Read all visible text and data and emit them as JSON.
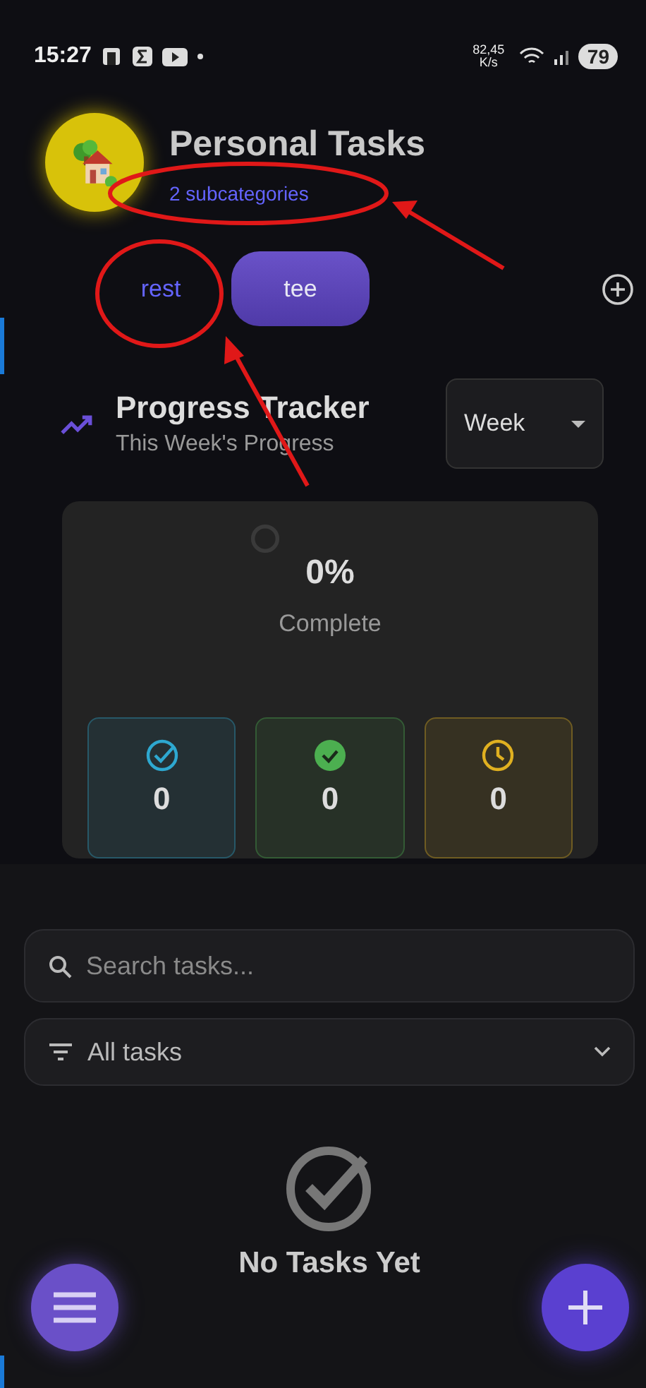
{
  "status_bar": {
    "time": "15:27",
    "net_speed": "82,45",
    "net_unit": "K/s",
    "battery": "79"
  },
  "header": {
    "title": "Personal Tasks",
    "subtitle": "2 subcategories"
  },
  "subcategories": [
    {
      "label": "rest",
      "selected": false
    },
    {
      "label": "tee",
      "selected": true
    }
  ],
  "progress": {
    "title": "Progress Tracker",
    "subtitle": "This Week's Progress",
    "period": "Week",
    "percent": "0%",
    "caption": "Complete",
    "stats": [
      {
        "kind": "target",
        "color": "#2ea8d0",
        "value": "0"
      },
      {
        "kind": "done",
        "color": "#4caf50",
        "value": "0"
      },
      {
        "kind": "pending",
        "color": "#e0b020",
        "value": "0"
      }
    ]
  },
  "search": {
    "placeholder": "Search tasks..."
  },
  "filter": {
    "value": "All tasks"
  },
  "empty_state": {
    "title": "No Tasks Yet"
  },
  "annotations": [
    {
      "kind": "ellipse"
    },
    {
      "kind": "arrow"
    },
    {
      "kind": "ellipse"
    },
    {
      "kind": "arrow"
    }
  ]
}
